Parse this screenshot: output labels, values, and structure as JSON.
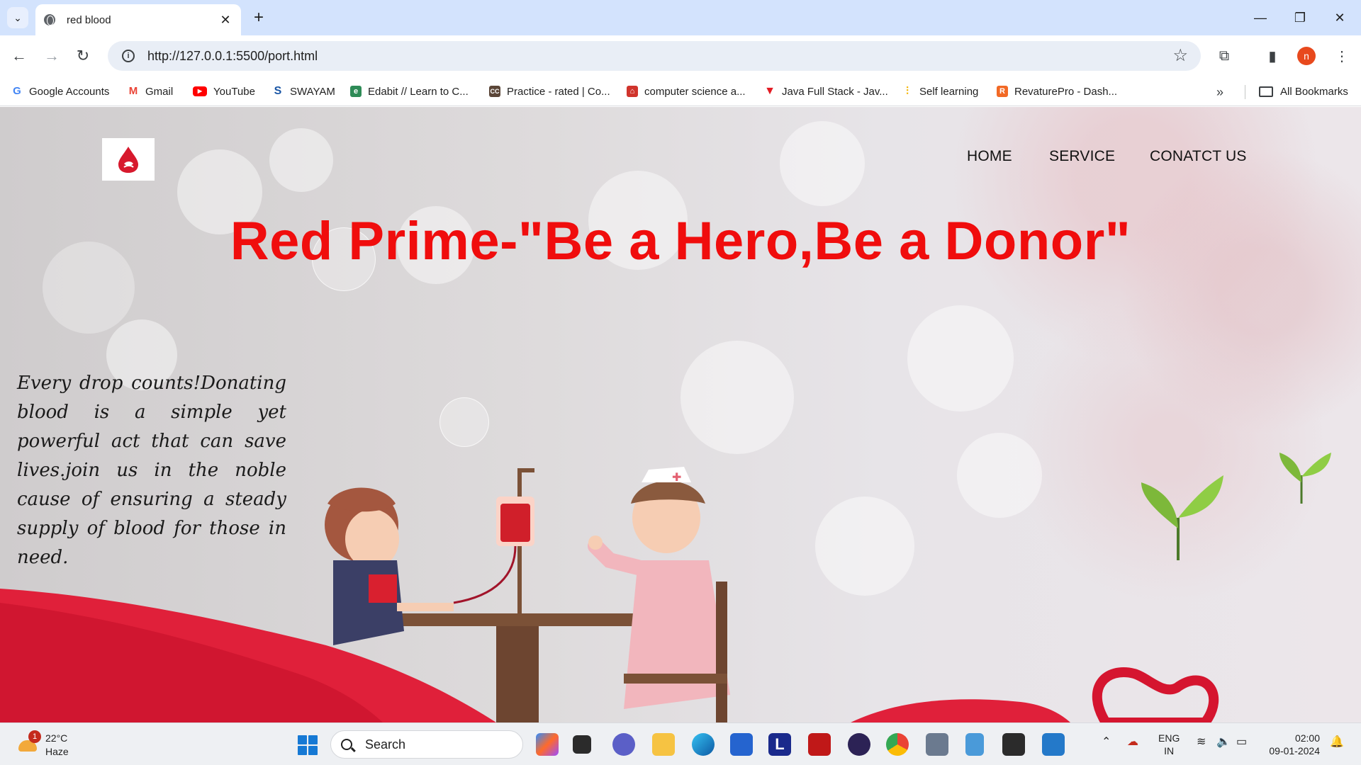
{
  "browser": {
    "tab_title": "red blood",
    "url": "http://127.0.0.1:5500/port.html",
    "profile_initial": "n",
    "bookmarks": [
      {
        "label": "Google Accounts",
        "icon": "google-icon",
        "color": "#4285f4"
      },
      {
        "label": "Gmail",
        "icon": "gmail-icon",
        "color": "#ea4335"
      },
      {
        "label": "YouTube",
        "icon": "youtube-icon",
        "color": "#ff0000"
      },
      {
        "label": "SWAYAM",
        "icon": "swayam-icon",
        "color": "#1a56a5"
      },
      {
        "label": "Edabit // Learn to C...",
        "icon": "edabit-icon",
        "color": "#2e8b57"
      },
      {
        "label": "Practice - rated | Co...",
        "icon": "codechef-icon",
        "color": "#5b4638"
      },
      {
        "label": "computer science a...",
        "icon": "geeks-icon",
        "color": "#d0342c"
      },
      {
        "label": "Java Full Stack - Jav...",
        "icon": "java-icon",
        "color": "#e31b23"
      },
      {
        "label": "Self learning",
        "icon": "chart-icon",
        "color": "#f4b400"
      },
      {
        "label": "RevaturePro - Dash...",
        "icon": "revature-icon",
        "color": "#f26925"
      }
    ],
    "all_bookmarks": "All Bookmarks"
  },
  "site": {
    "nav": [
      "HOME",
      "SERVICE",
      "CONATCT US"
    ],
    "title": "Red Prime-\"Be a Hero,Be a Donor\"",
    "tagline": "Every drop counts!Donating blood is a simple yet powerful act that can save lives.join us in the noble cause of ensuring a steady supply of blood for those in need.",
    "accent": "#f00d0d"
  },
  "taskbar": {
    "weather_badge": "1",
    "temperature": "22°C",
    "condition": "Haze",
    "search_label": "Search",
    "lang_top": "ENG",
    "lang_bottom": "IN",
    "time": "02:00",
    "date": "09-01-2024"
  }
}
